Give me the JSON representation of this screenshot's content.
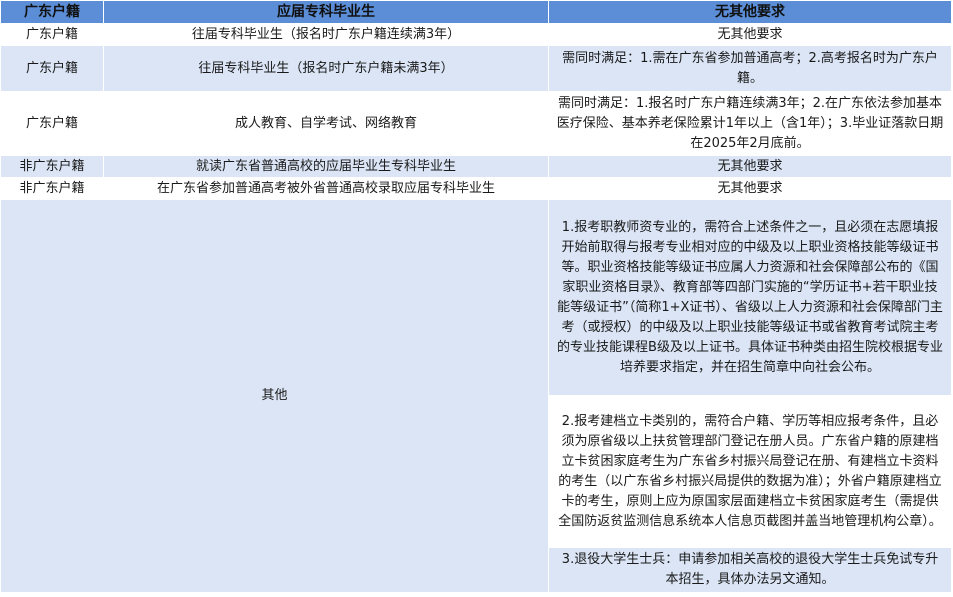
{
  "table": {
    "headers": [
      "广东户籍",
      "应届专科毕业生",
      "无其他要求"
    ],
    "rows": [
      {
        "col1": "广东户籍",
        "col2": "往届专科毕业生（报名时广东户籍连续满3年）",
        "col3": "无其他要求"
      },
      {
        "col1": "广东户籍",
        "col2": "往届专科毕业生（报名时广东户籍未满3年）",
        "col3": "需同时满足：1.需在广东省参加普通高考；2.高考报名时为广东户籍。"
      },
      {
        "col1": "广东户籍",
        "col2": "成人教育、自学考试、网络教育",
        "col3": "需同时满足：1.报名时广东户籍连续满3年；2.在广东依法参加基本医疗保险、基本养老保险累计1年以上（含1年）；3.毕业证落款日期在2025年2月底前。"
      },
      {
        "col1": "非广东户籍",
        "col2": "就读广东省普通高校的应届毕业生专科毕业生",
        "col3": "无其他要求"
      },
      {
        "col1": "非广东户籍",
        "col2": "在广东省参加普通高考被外省普通高校录取应届专科毕业生",
        "col3": "无其他要求"
      }
    ],
    "other": {
      "label": "其他",
      "notes": [
        "1.报考职教师资专业的，需符合上述条件之一，且必须在志愿填报开始前取得与报考专业相对应的中级及以上职业资格技能等级证书等。职业资格技能等级证书应属人力资源和社会保障部公布的《国家职业资格目录》、教育部等四部门实施的“学历证书+若干职业技能等级证书”（简称1+X证书）、省级以上人力资源和社会保障部门主考（或授权）的中级及以上职业技能等级证书或省教育考试院主考的专业技能课程B级及以上证书。具体证书种类由招生院校根据专业培养要求指定，并在招生简章中向社会公布。",
        "2.报考建档立卡类别的，需符合户籍、学历等相应报考条件，且必须为原省级以上扶贫管理部门登记在册人员。广东省户籍的原建档立卡贫困家庭考生为广东省乡村振兴局登记在册、有建档立卡资料的考生（以广东省乡村振兴局提供的数据为准）；外省户籍原建档立卡的考生，原则上应为原国家层面建档立卡贫困家庭考生（需提供全国防返贫监测信息系统本人信息页截图并盖当地管理机构公章）。",
        "3.退役大学生士兵：申请参加相关高校的退役大学生士兵免试专升本招生，具体办法另文通知。"
      ]
    }
  }
}
